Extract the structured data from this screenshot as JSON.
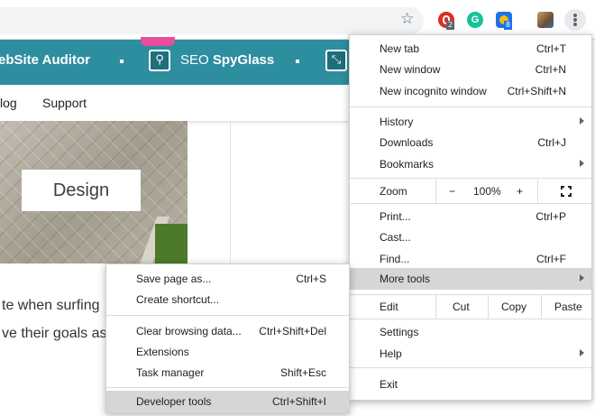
{
  "toolbar": {
    "star_icon": "star-icon",
    "extensions": [
      {
        "name": "red-extension-icon",
        "color": "#d93025",
        "badge": "2",
        "badge_color": "#5f6368"
      },
      {
        "name": "grammarly-icon",
        "color": "#15c39a",
        "glyph": "G"
      },
      {
        "name": "blue-extension-icon",
        "color": "#1a73e8",
        "badge": "8",
        "badge_color": "#1a73e8"
      },
      {
        "name": "avatar",
        "color": "#8a6d4b"
      }
    ],
    "menu_icon": "vertical-dots-icon"
  },
  "page": {
    "banner": {
      "color": "#2d8e9f",
      "left_text": "ebSite Auditor",
      "seo_prefix": "SEO ",
      "seo_bold": "SpyGlass"
    },
    "nav": [
      "log",
      "Support"
    ],
    "hero_label": "Design",
    "body_lines": [
      "te when surfing",
      "ve their goals as"
    ]
  },
  "main_menu": {
    "new_tab": {
      "label": "New tab",
      "accel": "Ctrl+T"
    },
    "new_window": {
      "label": "New window",
      "accel": "Ctrl+N"
    },
    "new_incognito": {
      "label": "New incognito window",
      "accel": "Ctrl+Shift+N"
    },
    "history": {
      "label": "History"
    },
    "downloads": {
      "label": "Downloads",
      "accel": "Ctrl+J"
    },
    "bookmarks": {
      "label": "Bookmarks"
    },
    "zoom": {
      "label": "Zoom",
      "minus": "−",
      "value": "100%",
      "plus": "+"
    },
    "print": {
      "label": "Print...",
      "accel": "Ctrl+P"
    },
    "cast": {
      "label": "Cast..."
    },
    "find": {
      "label": "Find...",
      "accel": "Ctrl+F"
    },
    "more_tools": {
      "label": "More tools"
    },
    "edit": {
      "label": "Edit",
      "cut": "Cut",
      "copy": "Copy",
      "paste": "Paste"
    },
    "settings": {
      "label": "Settings"
    },
    "help": {
      "label": "Help"
    },
    "exit": {
      "label": "Exit"
    }
  },
  "sub_menu": {
    "save_page": {
      "label": "Save page as...",
      "accel": "Ctrl+S"
    },
    "create_shortcut": {
      "label": "Create shortcut..."
    },
    "clear_data": {
      "label": "Clear browsing data...",
      "accel": "Ctrl+Shift+Del"
    },
    "extensions": {
      "label": "Extensions"
    },
    "task_manager": {
      "label": "Task manager",
      "accel": "Shift+Esc"
    },
    "developer_tools": {
      "label": "Developer tools",
      "accel": "Ctrl+Shift+I"
    }
  },
  "highlight_color": "#d6d6d6"
}
